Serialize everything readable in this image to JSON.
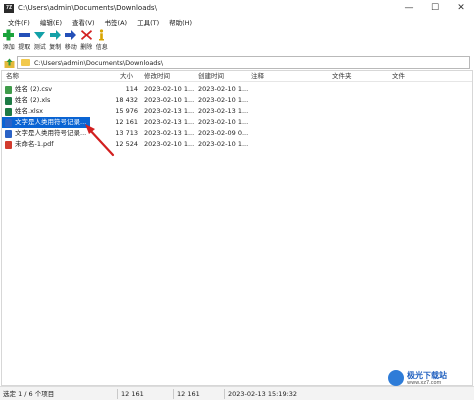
{
  "window": {
    "title": "C:\\Users\\admin\\Documents\\Downloads\\",
    "app_icon_text": "7Z",
    "controls": {
      "minimize": "—",
      "maximize": "☐",
      "close": "✕"
    }
  },
  "menu": [
    "文件(F)",
    "编辑(E)",
    "查看(V)",
    "书签(A)",
    "工具(T)",
    "帮助(H)"
  ],
  "toolbar": [
    {
      "label": "添加",
      "icon": "add-icon",
      "color": "#1aa33b"
    },
    {
      "label": "提取",
      "icon": "extract-icon",
      "color": "#2450b8"
    },
    {
      "label": "测试",
      "icon": "test-icon",
      "color": "#13a1a8"
    },
    {
      "label": "复制",
      "icon": "copy-icon",
      "color": "#13a1a8"
    },
    {
      "label": "移动",
      "icon": "move-icon",
      "color": "#2450b8"
    },
    {
      "label": "删除",
      "icon": "delete-icon",
      "color": "#d32020"
    },
    {
      "label": "信息",
      "icon": "info-icon",
      "color": "#d8a400"
    }
  ],
  "address": {
    "path": "C:\\Users\\admin\\Documents\\Downloads\\"
  },
  "columns": {
    "name": "名称",
    "size": "大小",
    "modified": "修改时间",
    "created": "创建时间",
    "comment": "注释",
    "folders": "文件夹",
    "files": "文件"
  },
  "files": [
    {
      "name": "姓名 (2).csv",
      "size": "114",
      "modified": "2023-02-10 1...",
      "created": "2023-02-10 1...",
      "type": "csv"
    },
    {
      "name": "姓名 (2).xls",
      "size": "18 432",
      "modified": "2023-02-10 1...",
      "created": "2023-02-10 1...",
      "type": "xls"
    },
    {
      "name": "姓名.xlsx",
      "size": "15 976",
      "modified": "2023-02-13 1...",
      "created": "2023-02-13 1...",
      "type": "xls"
    },
    {
      "name": "文字是人类用符号记录...",
      "size": "12 161",
      "modified": "2023-02-13 1...",
      "created": "2023-02-10 1...",
      "type": "doc",
      "selected": true
    },
    {
      "name": "文字是人类用符号记录...",
      "size": "13 713",
      "modified": "2023-02-13 1...",
      "created": "2023-02-09 0...",
      "type": "doc"
    },
    {
      "name": "未命名-1.pdf",
      "size": "12 524",
      "modified": "2023-02-10 1...",
      "created": "2023-02-10 1...",
      "type": "pdf"
    }
  ],
  "status": {
    "selection": "选定 1 / 6 个项目",
    "size1": "12 161",
    "size2": "12 161",
    "datetime": "2023-02-13 15:19:32"
  },
  "watermark": {
    "logo_text": "极光下载站",
    "url": "www.xz7.com"
  },
  "colors": {
    "selection": "#0a64d3",
    "arrow": "#d21f1f"
  }
}
